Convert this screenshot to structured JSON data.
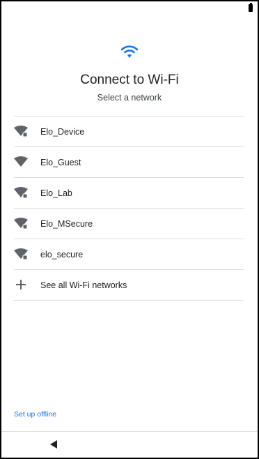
{
  "header": {
    "title": "Connect to Wi-Fi",
    "subtitle": "Select a network"
  },
  "colors": {
    "accent": "#1a73e8",
    "icon": "#5f6368",
    "divider": "#dadce0"
  },
  "networks": [
    {
      "name": "Elo_Device",
      "icon": "wifi-locked-icon"
    },
    {
      "name": "Elo_Guest",
      "icon": "wifi-icon"
    },
    {
      "name": "Elo_Lab",
      "icon": "wifi-locked-icon"
    },
    {
      "name": "Elo_MSecure",
      "icon": "wifi-locked-icon"
    },
    {
      "name": "elo_secure",
      "icon": "wifi-locked-icon"
    }
  ],
  "see_all": {
    "label": "See all Wi-Fi networks",
    "icon": "plus-icon"
  },
  "footer": {
    "offline_label": "Set up offline"
  },
  "navigation": {
    "back_icon": "back-triangle-icon"
  },
  "status_bar": {
    "battery_icon": "battery-icon"
  }
}
